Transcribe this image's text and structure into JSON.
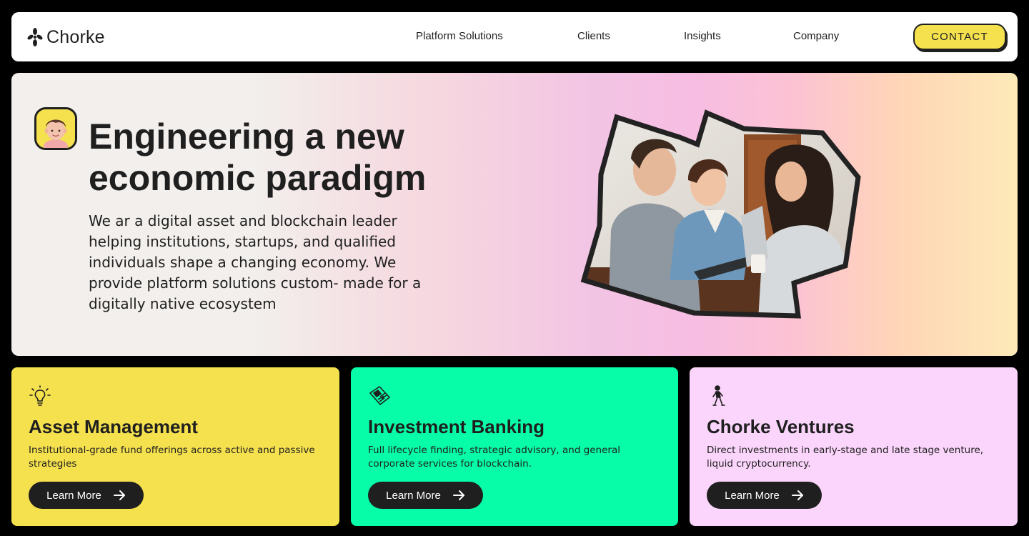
{
  "nav": {
    "brand": "Chorke",
    "links": [
      "Platform Solutions",
      "Clients",
      "Insights",
      "Company"
    ],
    "contact_label": "CONTACT"
  },
  "hero": {
    "title": "Engineering a new economic paradigm",
    "description": "We ar a digital asset and blockchain leader helping institutions, startups, and qualified individuals shape a changing economy. We provide platform solutions custom- made for a digitally native ecosystem",
    "avatar_icon": "avatar-face-icon",
    "photo_subject": "people-collaborating-photo"
  },
  "cards": [
    {
      "title": "Asset Management",
      "description": "Institutional-grade fund offerings across active and passive strategies",
      "button_label": "Learn More",
      "icon": "lightbulb-icon",
      "color": "#f5e14e"
    },
    {
      "title": "Investment Banking",
      "description": "Full lifecycle finding, strategic advisory, and general corporate services for blockchain.",
      "button_label": "Learn More",
      "icon": "newspaper-icon",
      "color": "#08fda8"
    },
    {
      "title": "Chorke Ventures",
      "description": "Direct investments in early-stage and late stage venture, liquid cryptocurrency.",
      "button_label": "Learn More",
      "icon": "walking-person-icon",
      "color": "#fbd5fb"
    }
  ],
  "colors": {
    "accent_yellow": "#f5e14e",
    "accent_green": "#08fda8",
    "accent_pink": "#fbd5fb",
    "ink": "#1f1f1f"
  }
}
